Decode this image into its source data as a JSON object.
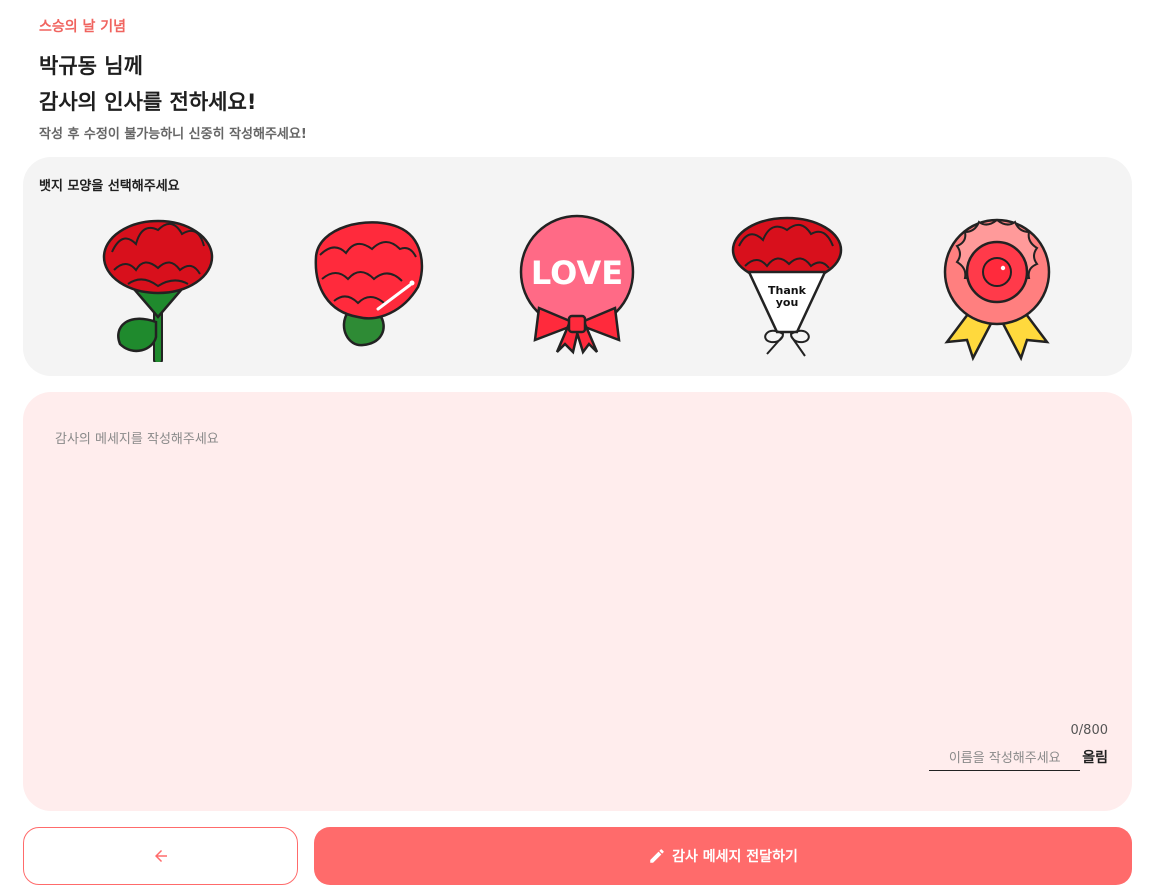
{
  "header": {
    "event_label": "스승의 날 기념",
    "title_line1": "박규동 님께",
    "title_line2": "감사의 인사를 전하세요!",
    "subtitle": "작성 후 수정이 불가능하니 신중히 작성해주세요!"
  },
  "badges": {
    "prompt": "뱃지 모양을 선택해주세요",
    "items": [
      {
        "icon": "carnation-stem-icon"
      },
      {
        "icon": "carnation-pencil-icon"
      },
      {
        "icon": "love-badge-icon",
        "text": "LOVE"
      },
      {
        "icon": "thank-you-bouquet-icon",
        "text_line1": "Thank",
        "text_line2": "you"
      },
      {
        "icon": "flower-rosette-icon"
      }
    ]
  },
  "message": {
    "placeholder": "감사의 메세지를 작성해주세요",
    "value": "",
    "counter": "0/800",
    "name_placeholder": "이름을 작성해주세요",
    "name_value": "",
    "suffix": "올림"
  },
  "actions": {
    "back_icon": "arrow-left-icon",
    "submit_icon": "pencil-icon",
    "submit_label": "감사 메세지 전달하기"
  },
  "colors": {
    "accent": "#ff6b6b",
    "badge_panel_bg": "#f4f4f4",
    "message_panel_bg": "#ffeded",
    "event_label": "#f0645f"
  }
}
